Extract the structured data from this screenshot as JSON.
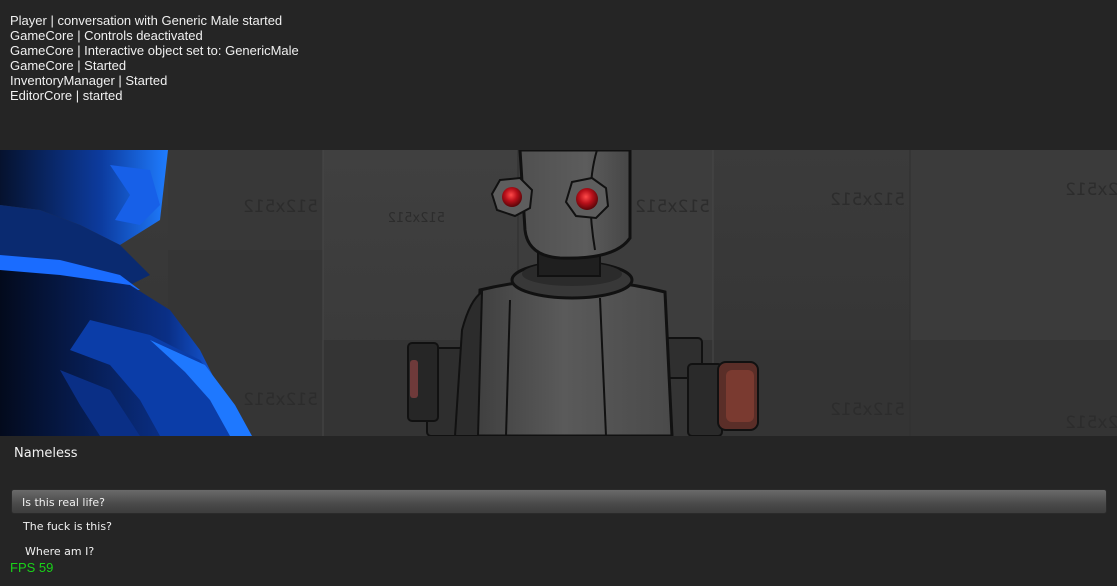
{
  "log": [
    "Player | conversation with Generic Male started",
    "GameCore | Controls deactivated",
    "GameCore | Interactive object set to: GenericMale",
    "GameCore | Started",
    "InventoryManager | Started",
    "EditorCore | started"
  ],
  "scene": {
    "wall_texture_label": "512x512",
    "player_color": "#1a6cff",
    "robot_eye_color": "#c0101a"
  },
  "dialogue": {
    "speaker": "Nameless",
    "options": [
      "Is this real life?",
      "The fuck is this?",
      "Where am I?"
    ],
    "selected_index": 0
  },
  "hud": {
    "fps": "FPS 59",
    "fps_color": "#19d219"
  }
}
